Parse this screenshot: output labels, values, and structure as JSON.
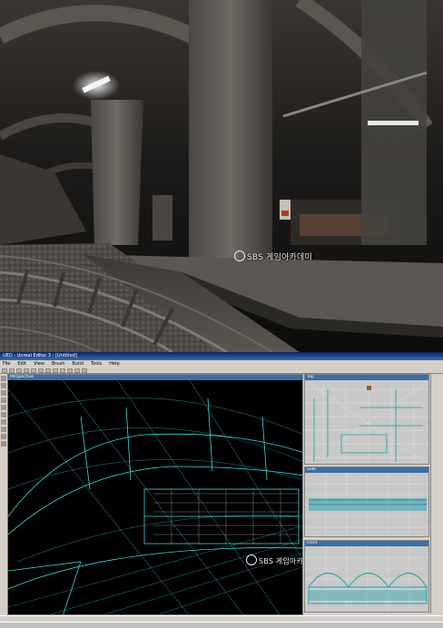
{
  "render": {
    "watermark": "SBS 게임아카데미"
  },
  "editor": {
    "window_title": "UED - Unreal Editor 3 - [Untitled]",
    "menu": [
      "File",
      "Edit",
      "View",
      "Brush",
      "Build",
      "Tools",
      "Help"
    ],
    "viewports": {
      "perspective": {
        "title": "Perspective",
        "watermark": "SBS 게임아카데미"
      },
      "top": {
        "title": "Top"
      },
      "side": {
        "title": "Side"
      },
      "front": {
        "title": "Front"
      }
    },
    "status": "",
    "taskbar": ""
  },
  "colors": {
    "wireframe": "#3fd8d8",
    "wire_dark": "#1e7a80",
    "ortho_bg": "#c8c8c8",
    "title_blue": "#3a6ea5"
  }
}
